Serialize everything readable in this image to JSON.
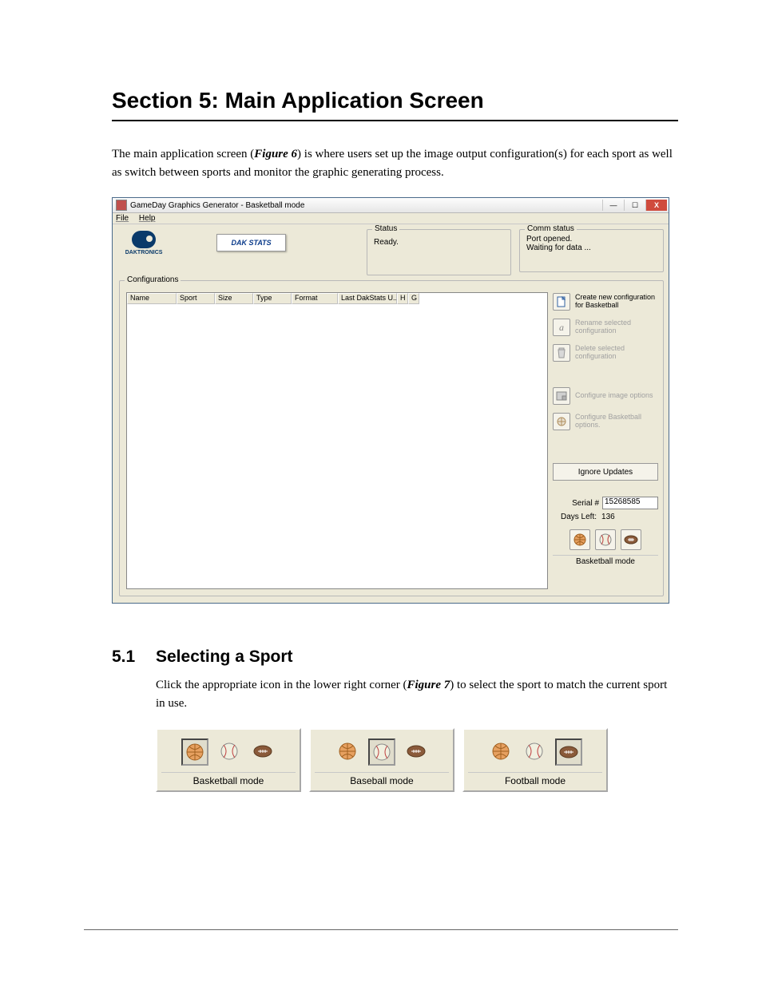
{
  "section": {
    "heading": "Section 5:    Main Application Screen",
    "para1_a": "The main application screen (",
    "para1_fig": "Figure 6",
    "para1_b": ") is where users set up the image output configuration(s) for each sport as well as switch between sports and monitor the graphic generating process."
  },
  "app": {
    "title": "GameDay Graphics Generator - Basketball mode",
    "menu": {
      "file": "File",
      "help": "Help"
    },
    "logo_text": "DAKTRONICS",
    "dakstats": "DAK STATS",
    "status": {
      "legend": "Status",
      "value": "Ready."
    },
    "comm": {
      "legend": "Comm status",
      "line1": "Port opened.",
      "line2": "Waiting for data ..."
    },
    "configurations": {
      "legend": "Configurations",
      "headers": [
        "Name",
        "Sport",
        "Size",
        "Type",
        "Format",
        "Last DakStats U...",
        "H",
        "G"
      ]
    },
    "actions": {
      "create": "Create new configuration for Basketball",
      "rename": "Rename selected configuration",
      "delete": "Delete selected configuration",
      "image_opts": "Configure image options",
      "sport_opts": "Configure Basketball options.",
      "ignore": "Ignore Updates"
    },
    "serial": {
      "label": "Serial #",
      "value": "15268585"
    },
    "days": {
      "label": "Days Left:",
      "value": "136"
    },
    "mode_label": "Basketball mode"
  },
  "subsection": {
    "num": "5.1",
    "title": "Selecting a Sport",
    "para_a": "Click the appropriate icon in the lower right corner (",
    "para_fig": "Figure 7",
    "para_b": ") to select the sport to match the current sport in use."
  },
  "modes": {
    "basketball": "Basketball mode",
    "baseball": "Baseball mode",
    "football": "Football mode"
  }
}
